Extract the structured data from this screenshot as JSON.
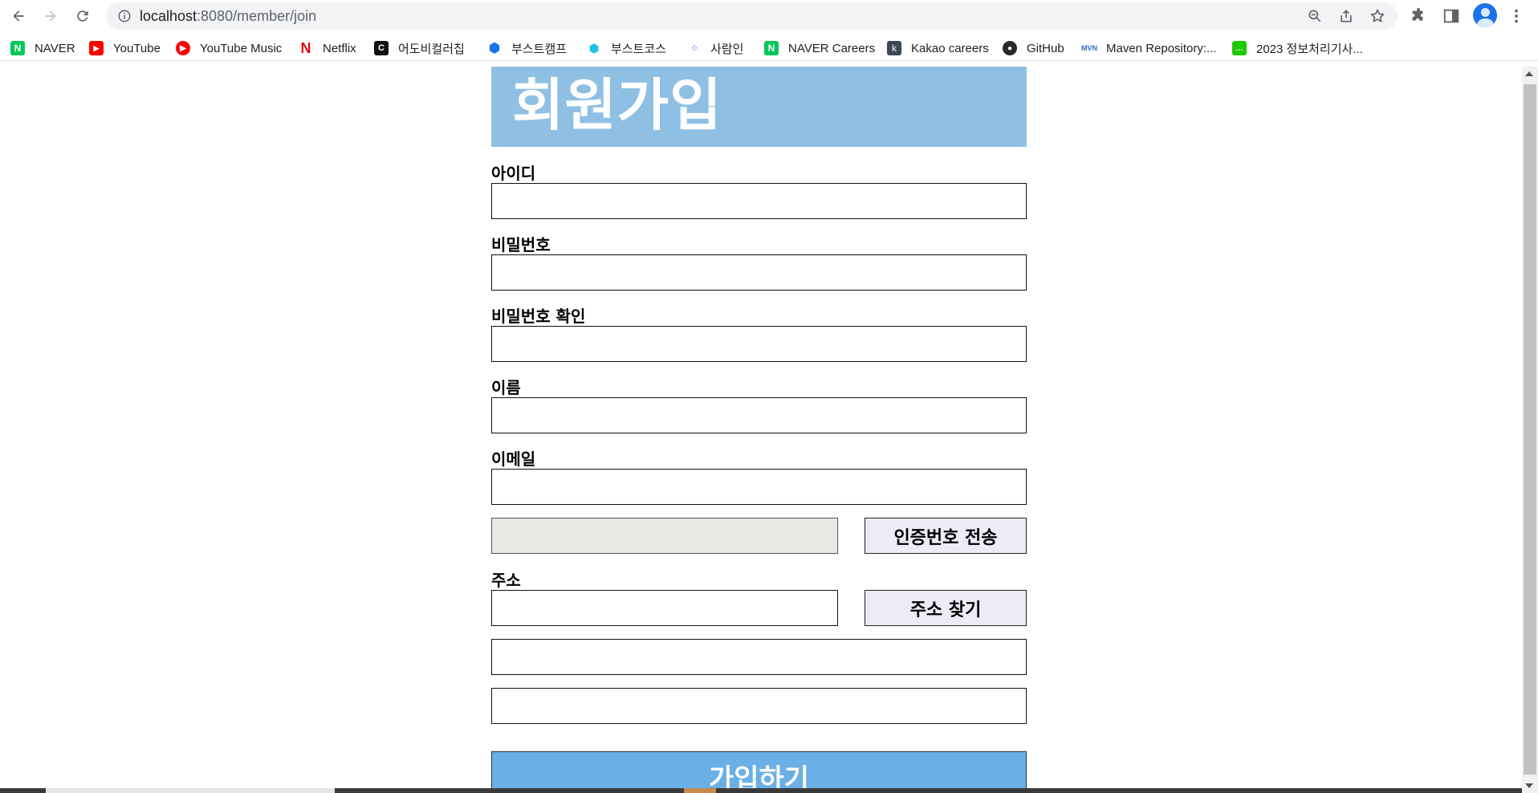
{
  "browser": {
    "url_host": "localhost",
    "url_rest": ":8080/member/join",
    "bookmarks": [
      {
        "label": "NAVER",
        "color": "#03c75a",
        "glyph": "N"
      },
      {
        "label": "YouTube",
        "color": "#ff0000",
        "glyph": "▶"
      },
      {
        "label": "YouTube Music",
        "color": "#ff0000",
        "glyph": "♪"
      },
      {
        "label": "Netflix",
        "color": "#e50914",
        "glyph": "N"
      },
      {
        "label": "어도비컬러칩",
        "color": "#111111",
        "glyph": "C"
      },
      {
        "label": "부스트캠프",
        "color": "#1a73e8",
        "glyph": "◆"
      },
      {
        "label": "부스트코스",
        "color": "#19c3e6",
        "glyph": "◆"
      },
      {
        "label": "사람인",
        "color": "#6c8cff",
        "glyph": "●"
      },
      {
        "label": "NAVER Careers",
        "color": "#03c75a",
        "glyph": "N"
      },
      {
        "label": "Kakao careers",
        "color": "#3c4654",
        "glyph": "k"
      },
      {
        "label": "GitHub",
        "color": "#24292e",
        "glyph": "●"
      },
      {
        "label": "Maven Repository:...",
        "color": "#2e6bc6",
        "glyph": "M"
      },
      {
        "label": "2023 정보처리기사...",
        "color": "#1ec800",
        "glyph": "…"
      }
    ]
  },
  "page": {
    "title": "회원가입",
    "fields": {
      "id_label": "아이디",
      "password_label": "비밀번호",
      "password_confirm_label": "비밀번호 확인",
      "name_label": "이름",
      "email_label": "이메일",
      "address_label": "주소"
    },
    "buttons": {
      "send_code": "인증번호 전송",
      "find_address": "주소 찾기",
      "submit": "가입하기"
    }
  }
}
